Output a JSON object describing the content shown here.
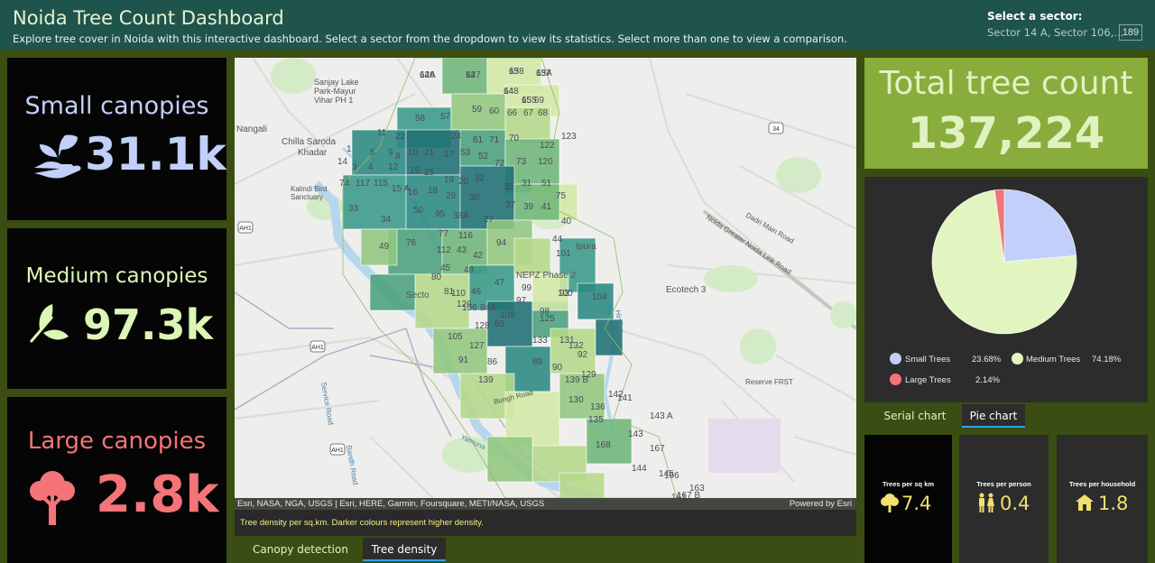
{
  "header": {
    "title": "Noida Tree Count Dashboard",
    "subtitle": "Explore tree cover in Noida with this interactive dashboard. Select a sector from the dropdown to view its statistics. Select more than one to view a comparison.",
    "sector_label": "Select a sector:",
    "sector_value": "Sector 14 A, Sector 106,...",
    "sector_count": "189"
  },
  "cards": [
    {
      "label": "Small canopies",
      "value": "31.1k",
      "icon": "hand-sprout-icon",
      "color": "#c2cffb"
    },
    {
      "label": "Medium canopies",
      "value": "97.3k",
      "icon": "leaves-icon",
      "color": "#dcf7b5"
    },
    {
      "label": "Large canopies",
      "value": "2.8k",
      "icon": "tree-icon",
      "color": "#f47479"
    }
  ],
  "map": {
    "attribution": "Esri, NASA, NGA, USGS | Esri, HERE, Garmin, Foursquare, METI/NASA, USGS",
    "powered_by": "Powered by Esri",
    "caption": "Tree density per sq.km. Darker colours represent higher density.",
    "places": [
      "Sanjay Lake",
      "Park-Mayur",
      "Vihar PH 1",
      "Nangali",
      "Chilla Saroda",
      "Khadar",
      "Kalindi Bird",
      "Sanctuary",
      "Ipura",
      "NEPZ Phase 2",
      "Ecotech 3",
      "Dadri Main Road",
      "Noida Greater Noida Link Road",
      "Reserve FRST",
      "Service Road",
      "Bandh Road",
      "Hindon",
      "Yamuna",
      "Bungh Road",
      "Secto"
    ],
    "road_labels": [
      "AH1",
      "AH1",
      "AH1",
      "34"
    ],
    "sector_labels": [
      "62A",
      "63",
      "63A",
      "62",
      "64",
      "65",
      "69",
      "58",
      "57",
      "59",
      "60",
      "66",
      "67",
      "68",
      "122",
      "123",
      "11",
      "22",
      "24",
      "70",
      "61",
      "71",
      "1",
      "5",
      "9",
      "10",
      "21",
      "17",
      "8",
      "53",
      "52",
      "72",
      "73",
      "120",
      "14",
      "3",
      "4",
      "12",
      "15",
      "25",
      "19",
      "20",
      "32",
      "35",
      "31",
      "51",
      "75",
      "74",
      "117",
      "115",
      "15 A",
      "16",
      "18",
      "29",
      "30",
      "33",
      "34",
      "50",
      "95",
      "38A",
      "27",
      "37",
      "39",
      "41",
      "40",
      "49",
      "76",
      "77",
      "116",
      "112",
      "94",
      "44",
      "43",
      "42",
      "45",
      "48",
      "101",
      "80",
      "81",
      "46",
      "47",
      "99",
      "100",
      "104",
      "110",
      "106",
      "84A",
      "83",
      "97",
      "98",
      "105",
      "108",
      "93",
      "126",
      "127",
      "128",
      "125",
      "131",
      "132",
      "133",
      "92",
      "91",
      "86",
      "139",
      "90",
      "89",
      "139 B",
      "129",
      "136",
      "130",
      "135",
      "141",
      "142",
      "143 A",
      "143",
      "168",
      "167",
      "144",
      "166",
      "145",
      "163",
      "167 B",
      "161",
      "146",
      "158",
      "157",
      "147",
      "148",
      "155"
    ]
  },
  "tabs_bottom": [
    {
      "label": "Canopy detection",
      "active": false
    },
    {
      "label": "Tree density",
      "active": true
    }
  ],
  "total": {
    "label": "Total tree count",
    "value": "137,224"
  },
  "pie": {
    "title": "",
    "slices": [
      {
        "name": "Small Trees",
        "pct": "23.68%",
        "value": 23.68,
        "color": "#c2cffb"
      },
      {
        "name": "Medium Trees",
        "pct": "74.18%",
        "value": 74.18,
        "color": "#e2f5c1"
      },
      {
        "name": "Large Trees",
        "pct": "2.14%",
        "value": 2.14,
        "color": "#f47479"
      }
    ]
  },
  "tabs_right": [
    {
      "label": "Serial chart",
      "active": false
    },
    {
      "label": "Pie chart",
      "active": true
    }
  ],
  "stats": [
    {
      "label": "Trees per sq km",
      "value": "7.4",
      "icon": "tree-icon"
    },
    {
      "label": "Trees per person",
      "value": "0.4",
      "icon": "people-icon"
    },
    {
      "label": "Trees per household",
      "value": "1.8",
      "icon": "house-icon"
    }
  ],
  "chart_data": {
    "type": "pie",
    "categories": [
      "Small Trees",
      "Medium Trees",
      "Large Trees"
    ],
    "values": [
      23.68,
      74.18,
      2.14
    ],
    "legend": "bottom"
  }
}
